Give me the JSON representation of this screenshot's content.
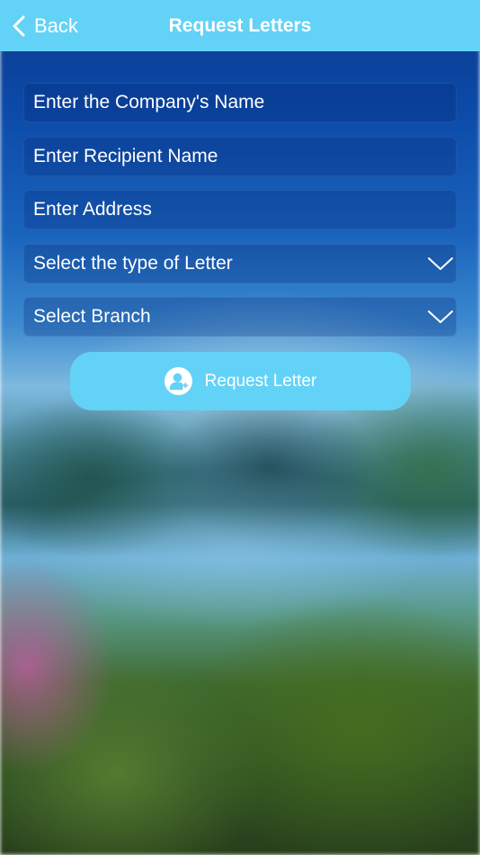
{
  "header": {
    "back_label": "Back",
    "title": "Request Letters"
  },
  "form": {
    "company_placeholder": "Enter the Company's Name",
    "recipient_placeholder": "Enter Recipient Name",
    "address_placeholder": "Enter Address",
    "letter_type_label": "Select the type of Letter",
    "branch_label": "Select Branch"
  },
  "action": {
    "request_label": "Request Letter",
    "icon": "add-user-icon"
  },
  "colors": {
    "header_bg": "#63d2f7",
    "button_bg": "#63d2f7",
    "text": "#ffffff"
  }
}
